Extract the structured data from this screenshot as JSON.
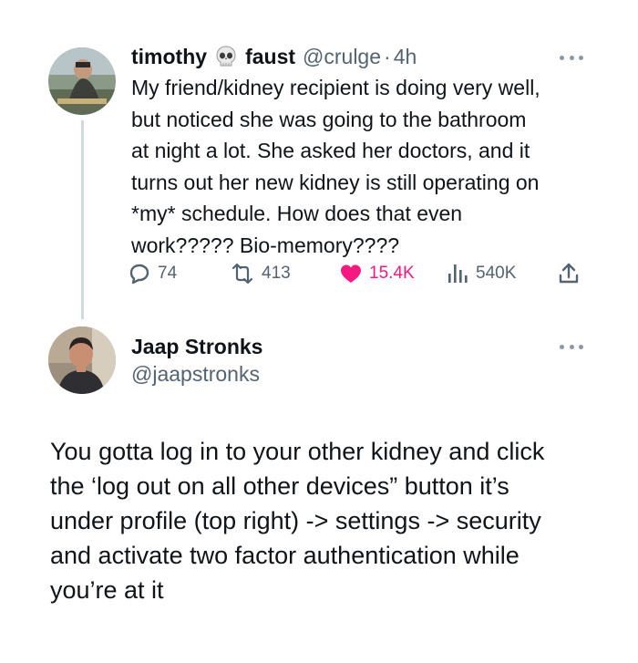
{
  "tweet": {
    "author_name_first": "timothy",
    "author_name_emoji": "skull",
    "author_name_last": "faust",
    "handle": "@crulge",
    "separator": "·",
    "time": "4h",
    "text_lines": [
      "My friend/kidney recipient is doing very well,",
      "but noticed she was going to the bathroom",
      "at night a lot. She asked her doctors, and it",
      "turns out her new kidney is still operating on",
      "*my* schedule. How does that even",
      "work????? Bio-memory????"
    ],
    "replies": "74",
    "reposts": "413",
    "likes": "15.4K",
    "views": "540K",
    "like_color": "#f91880"
  },
  "reply": {
    "author_name": "Jaap Stronks",
    "handle": "@jaapstronks",
    "text_lines": [
      "You gotta log in to your other kidney and click",
      "the ‘log out on all other devices” button it’s",
      "under profile (top right) -> settings -> security",
      "and activate two factor authentication while",
      "you’re at it"
    ]
  },
  "icons": {
    "reply": "reply-icon",
    "repost": "repost-icon",
    "like": "heart-icon",
    "views": "views-icon",
    "share": "share-icon",
    "more": "more-icon"
  }
}
